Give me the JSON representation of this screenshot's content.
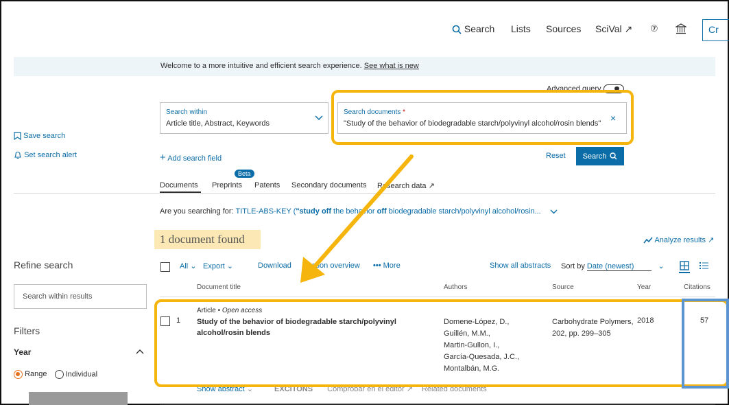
{
  "topnav": {
    "search": "Search",
    "lists": "Lists",
    "sources": "Sources",
    "scival": "SciVal ↗",
    "help": "⑦",
    "institution": "🏛",
    "create_partial": "Cr"
  },
  "banner": {
    "text": "Welcome to a more intuitive and efficient search experience.",
    "link": "See what is new"
  },
  "sidebar": {
    "save_search": "Save search",
    "set_alert": "Set search alert",
    "refine_title": "Refine search",
    "search_within_placeholder": "Search within results",
    "filters_title": "Filters",
    "year_label": "Year",
    "range_label": "Range",
    "individual_label": "Individual"
  },
  "search_form": {
    "advanced_query": "Advanced query",
    "within_label": "Search within",
    "within_value": "Article title, Abstract, Keywords",
    "documents_label": "Search documents",
    "required_mark": "*",
    "documents_value": "\"Study of the behavior of biodegradable starch/polyvinyl alcohol/rosin blends\"",
    "add_field": "Add search field",
    "reset": "Reset",
    "search_button": "Search"
  },
  "tabs": {
    "documents": "Documents",
    "preprints": "Preprints",
    "beta_badge": "Beta",
    "patents": "Patents",
    "secondary": "Secondary documents",
    "research_data": "Research data ↗"
  },
  "suggestion": {
    "prefix": "Are you searching for:",
    "query_start": "TITLE-ABS-KEY (",
    "quote_study": "\"study",
    "off1": "off",
    "middle": "the behavior",
    "off2": "off",
    "rest": "biodegradable starch/polyvinyl alcohol/rosin..."
  },
  "results": {
    "count_text": "1 document found",
    "analyze": "Analyze results ↗",
    "all": "All",
    "export": "Export",
    "download": "Download",
    "citation_overview": "Citation overview",
    "more": "More",
    "show_all_abstracts": "Show all abstracts",
    "sort_by_label": "Sort by",
    "sort_value": "Date (newest)",
    "columns": {
      "title": "Document title",
      "authors": "Authors",
      "source": "Source",
      "year": "Year",
      "citations": "Citations"
    },
    "rows": [
      {
        "index": "1",
        "type": "Article",
        "access": "Open access",
        "title_line1": "Study of the behavior of biodegradable starch/polyvinyl",
        "title_line2": "alcohol/rosin blends",
        "authors": [
          "Domene-López, D.,",
          "Guillén, M.M.,",
          "Martin-Gullon, I.,",
          "García-Quesada, J.C.,",
          "Montalbán, M.G."
        ],
        "source_line1": "Carbohydrate Polymers,",
        "source_line2": "202, pp. 299–305",
        "year": "2018",
        "citations": "57"
      }
    ],
    "row_actions": {
      "show_abstract": "Show abstract",
      "excitons": "EXCITONS",
      "full_text": "Comprobar en el editor ↗",
      "related": "Related documents"
    }
  },
  "colors": {
    "accent": "#0b6da7",
    "highlight_orange": "#f5b50d",
    "highlight_blue": "#5b95d1",
    "banner_bg": "#eef5f9"
  }
}
